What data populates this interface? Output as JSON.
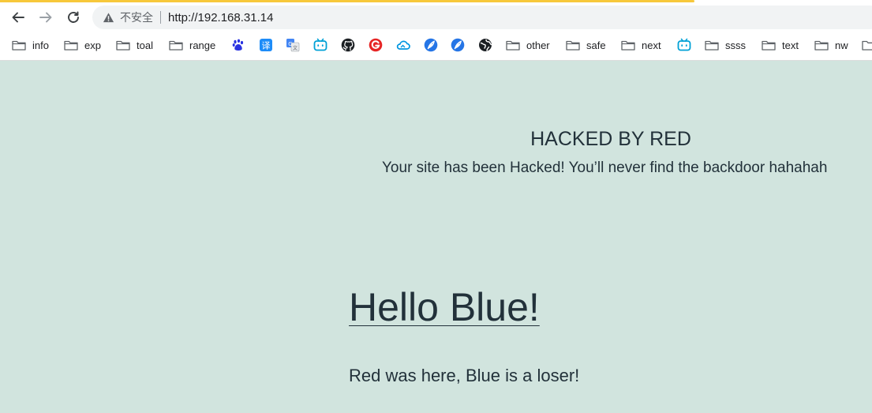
{
  "browser": {
    "security_label": "不安全",
    "url": "http://192.168.31.14"
  },
  "bookmarks": {
    "folders": [
      "info",
      "exp",
      "toal",
      "range",
      "other",
      "safe",
      "next",
      "ssss",
      "text",
      "nw"
    ],
    "icons": [
      "baidu-icon",
      "translate-icon",
      "google-translate-icon",
      "bilibili-icon",
      "github-icon",
      "red-g-icon",
      "cloud-icon",
      "feather-icon",
      "feather-icon",
      "globe-icon",
      "bilibili-icon"
    ]
  },
  "page": {
    "hacked_title": "HACKED BY RED",
    "hacked_message": "Your site has been Hacked! You’ll never find the backdoor hahahah",
    "hello_link": "Hello Blue!",
    "loser_text": "Red was here, Blue is a loser!"
  }
}
